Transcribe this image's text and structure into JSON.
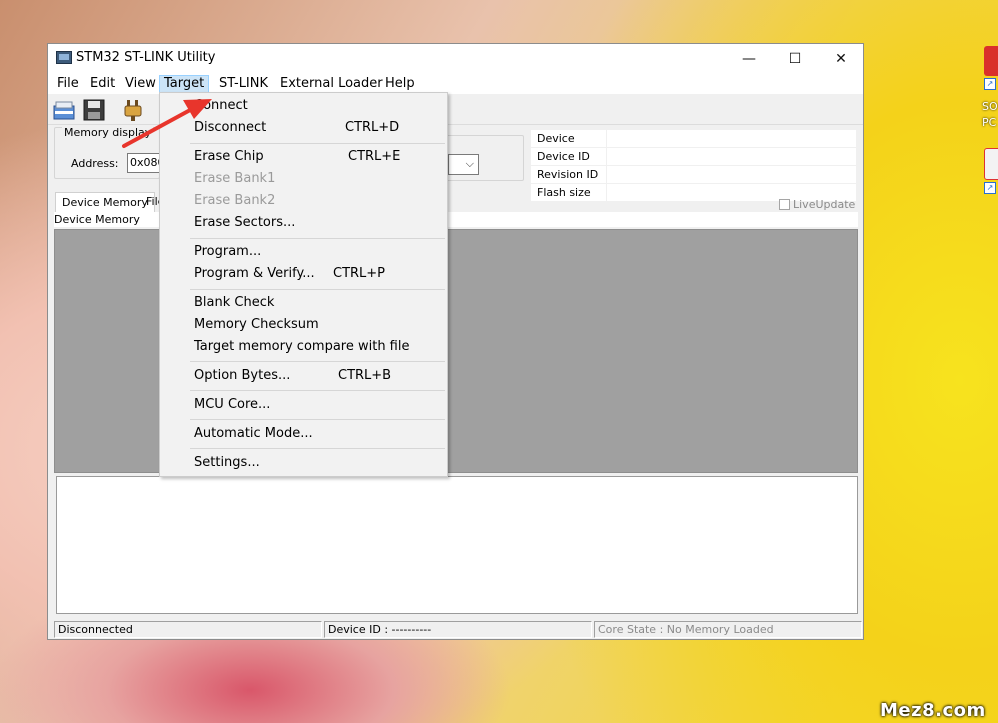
{
  "window": {
    "title": "STM32 ST-LINK Utility",
    "controls": {
      "minimize": "—",
      "maximize": "☐",
      "close": "✕"
    }
  },
  "menubar": [
    "File",
    "Edit",
    "View",
    "Target",
    "ST-LINK",
    "External Loader",
    "Help"
  ],
  "toolbar": {
    "icons": [
      "open-file-icon",
      "save-icon",
      "connect-plug-icon"
    ]
  },
  "memory_display": {
    "group_label": "Memory display",
    "address_label": "Address:",
    "address_value": "0x0800"
  },
  "device_info": [
    {
      "key": "Device",
      "value": ""
    },
    {
      "key": "Device ID",
      "value": ""
    },
    {
      "key": "Revision ID",
      "value": ""
    },
    {
      "key": "Flash size",
      "value": ""
    }
  ],
  "live_update": "LiveUpdate",
  "tabs": {
    "device_memory": "Device Memory",
    "file": "File"
  },
  "panel_header": "Device Memory",
  "status": {
    "connection": "Disconnected",
    "device_id": "Device ID : ----------",
    "core_state": "Core State : No Memory Loaded"
  },
  "target_menu": {
    "items": [
      {
        "label": "Connect",
        "shortcut": "",
        "disabled": false
      },
      {
        "label": "Disconnect",
        "shortcut": "CTRL+D",
        "disabled": false
      },
      {
        "label": "Erase Chip",
        "shortcut": "CTRL+E",
        "disabled": false
      },
      {
        "label": "Erase Bank1",
        "shortcut": "",
        "disabled": true
      },
      {
        "label": "Erase Bank2",
        "shortcut": "",
        "disabled": true
      },
      {
        "label": "Erase Sectors...",
        "shortcut": "",
        "disabled": false
      },
      {
        "label": "Program...",
        "shortcut": "",
        "disabled": false
      },
      {
        "label": "Program & Verify...",
        "shortcut": "CTRL+P",
        "disabled": false
      },
      {
        "label": "Blank Check",
        "shortcut": "",
        "disabled": false
      },
      {
        "label": "Memory Checksum",
        "shortcut": "",
        "disabled": false
      },
      {
        "label": "Target memory compare with file",
        "shortcut": "",
        "disabled": false
      },
      {
        "label": "Option Bytes...",
        "shortcut": "CTRL+B",
        "disabled": false
      },
      {
        "label": "MCU Core...",
        "shortcut": "",
        "disabled": false
      },
      {
        "label": "Automatic Mode...",
        "shortcut": "",
        "disabled": false
      },
      {
        "label": "Settings...",
        "shortcut": "",
        "disabled": false
      }
    ]
  },
  "desktop": {
    "label1": "SO",
    "label2": "PC"
  },
  "watermark": "Mez8.com",
  "colors": {
    "annotation_arrow": "#e8352c",
    "active_menu_bg": "#cce4f7",
    "memory_area": "#a0a0a0"
  }
}
